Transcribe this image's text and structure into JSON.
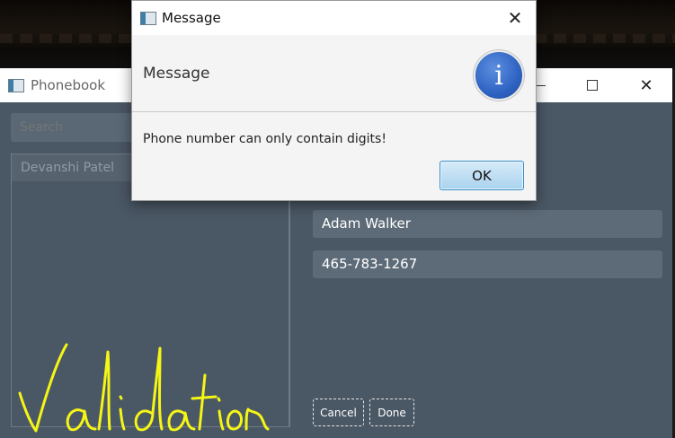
{
  "phonebook_window": {
    "title": "Phonebook",
    "search": {
      "placeholder": "Search",
      "value": ""
    },
    "contacts": [
      "Devanshi Patel"
    ],
    "name_field": "Adam Walker",
    "phone_field": "465-783-1267",
    "cancel_label": "Cancel",
    "done_label": "Done",
    "minimize_glyph": "",
    "close_glyph": "✕"
  },
  "dialog": {
    "title": "Message",
    "header_text": "Message",
    "message": "Phone number can only contain digits!",
    "ok_label": "OK",
    "close_glyph": "✕",
    "icon_glyph": "i"
  },
  "annotation": {
    "text": "Validation",
    "color": "#f5f516"
  },
  "colors": {
    "window_bg": "#4a5764",
    "field_bg": "#5d6b78",
    "ok_border": "#3a8fc6",
    "info_blue": "#2f63c2"
  }
}
